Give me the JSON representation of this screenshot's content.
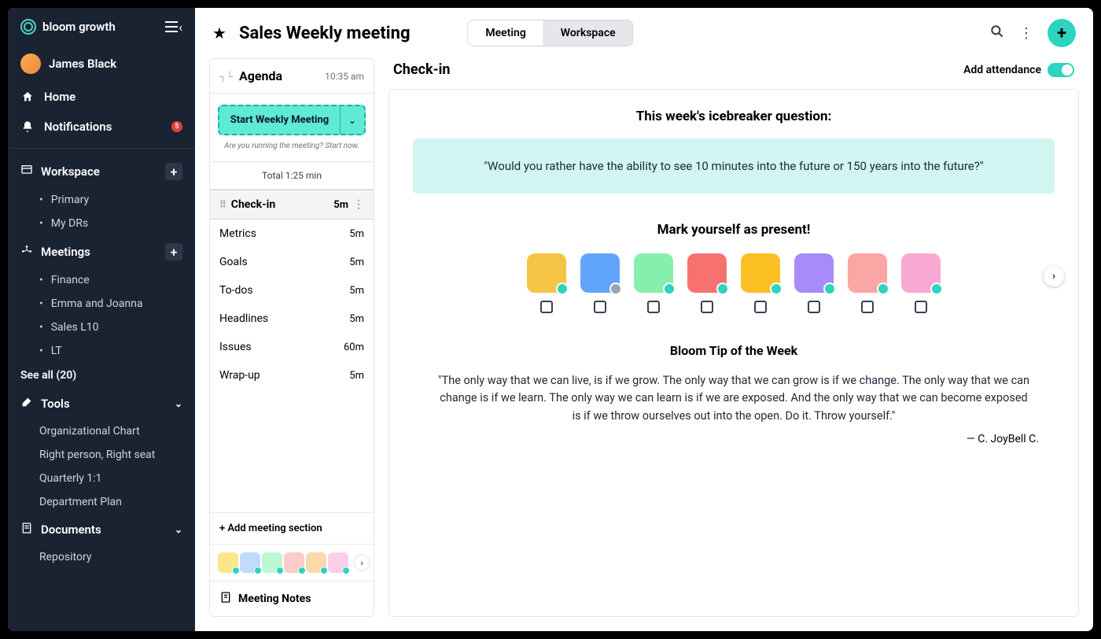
{
  "brand": "bloom growth",
  "user": "James Black",
  "nav": {
    "home": "Home",
    "notifications": "Notifications",
    "notif_count": "5"
  },
  "workspace": {
    "title": "Workspace",
    "items": [
      "Primary",
      "My DRs"
    ]
  },
  "meetings": {
    "title": "Meetings",
    "items": [
      "Finance",
      "Emma and Joanna",
      "Sales L10",
      "LT"
    ],
    "see_all": "See all (20)"
  },
  "tools": {
    "title": "Tools",
    "items": [
      "Organizational Chart",
      "Right person, Right seat",
      "Quarterly 1:1",
      "Department Plan"
    ]
  },
  "documents": {
    "title": "Documents",
    "items": [
      "Repository"
    ]
  },
  "header": {
    "title": "Sales Weekly meeting",
    "tab_meeting": "Meeting",
    "tab_workspace": "Workspace"
  },
  "agenda": {
    "title": "Agenda",
    "time": "10:35 am",
    "start_label": "Start Weekly Meeting",
    "start_note": "Are you running the meeting? Start now.",
    "total": "Total 1:25 min",
    "items": [
      {
        "label": "Check-in",
        "dur": "5m",
        "active": true
      },
      {
        "label": "Metrics",
        "dur": "5m"
      },
      {
        "label": "Goals",
        "dur": "5m"
      },
      {
        "label": "To-dos",
        "dur": "5m"
      },
      {
        "label": "Headlines",
        "dur": "5m"
      },
      {
        "label": "Issues",
        "dur": "60m"
      },
      {
        "label": "Wrap-up",
        "dur": "5m"
      }
    ],
    "add_section": "+ Add meeting section",
    "notes": "Meeting Notes"
  },
  "checkin": {
    "title": "Check-in",
    "attendance_label": "Add attendance",
    "icebreaker_head": "This week's icebreaker question:",
    "icebreaker_q": "\"Would you rather have the ability to see 10 minutes into the future or 150 years into the future?\"",
    "present_head": "Mark yourself as present!",
    "tip_head": "Bloom Tip of the Week",
    "tip_quote": "\"The only way that we can live, is if we grow. The only way that we can grow is if we change. The only way that we can change is if we learn. The only way we can learn is if we are exposed. And the only way that we can become exposed is if we throw ourselves out into the open. Do it. Throw yourself.\"",
    "tip_author": "— C. JoyBell C."
  },
  "avatar_colors": [
    "#f6c445",
    "#60a5fa",
    "#86efac",
    "#f87171",
    "#fbbf24",
    "#a78bfa",
    "#fca5a5",
    "#f9a8d4"
  ],
  "mini_colors": [
    "#fde68a",
    "#bfdbfe",
    "#bbf7d0",
    "#fecaca",
    "#fed7aa",
    "#fbcfe8"
  ]
}
